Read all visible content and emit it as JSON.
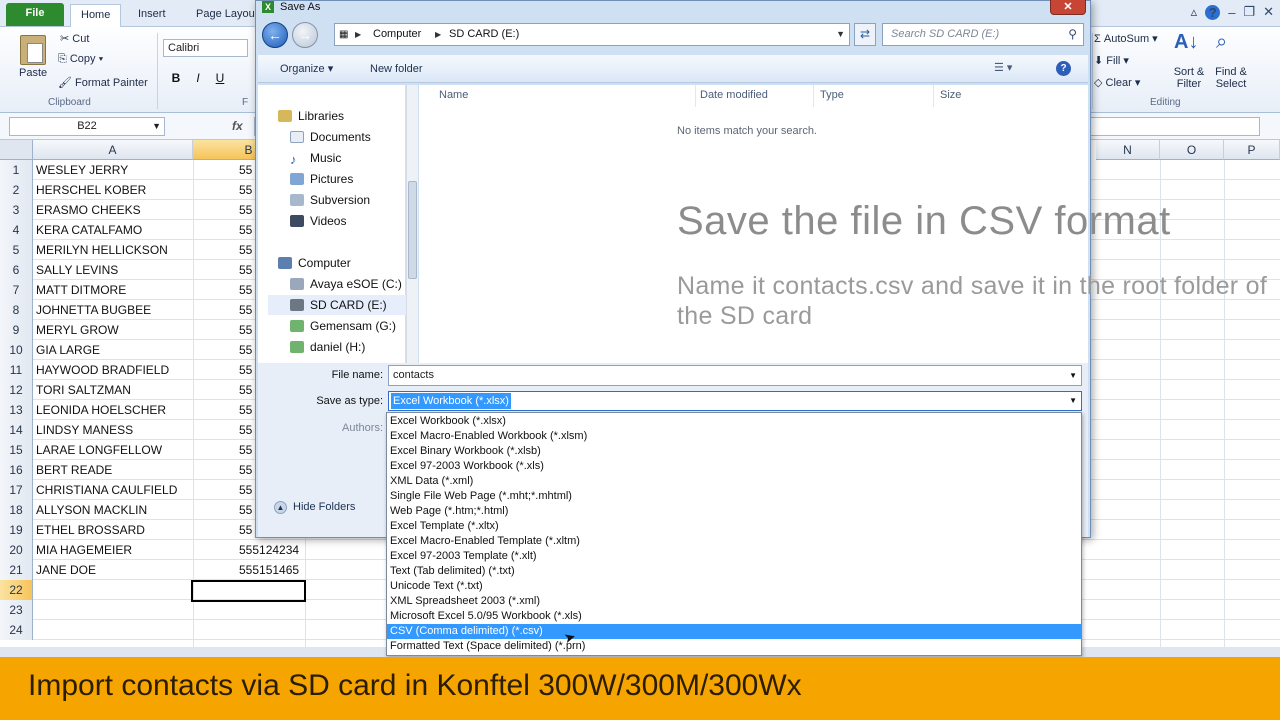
{
  "excel": {
    "tabs": [
      "File",
      "Home",
      "Insert",
      "Page Layou"
    ],
    "clipboard": {
      "paste": "Paste",
      "cut": "Cut",
      "copy": "Copy",
      "format_painter": "Format Painter",
      "label": "Clipboard"
    },
    "font": {
      "name": "Calibri",
      "bold": "B",
      "italic": "I",
      "underline": "U",
      "label_fragment": "F"
    },
    "editing": {
      "autosum": "AutoSum",
      "fill": "Fill",
      "clear": "Clear",
      "sort_filter": "Sort & Filter",
      "find_select": "Find & Select",
      "label": "Editing"
    },
    "name_box": "B22",
    "fx": "fx",
    "columns": {
      "a": "A",
      "b": "B",
      "n": "N",
      "o": "O",
      "p": "P"
    },
    "rows": [
      {
        "num": "1",
        "name": "WESLEY JERRY",
        "phone": "55"
      },
      {
        "num": "2",
        "name": "HERSCHEL KOBER",
        "phone": "55"
      },
      {
        "num": "3",
        "name": "ERASMO CHEEKS",
        "phone": "55"
      },
      {
        "num": "4",
        "name": "KERA CATALFAMO",
        "phone": "55"
      },
      {
        "num": "5",
        "name": "MERILYN HELLICKSON",
        "phone": "55"
      },
      {
        "num": "6",
        "name": "SALLY LEVINS",
        "phone": "55"
      },
      {
        "num": "7",
        "name": "MATT DITMORE",
        "phone": "55"
      },
      {
        "num": "8",
        "name": "JOHNETTA BUGBEE",
        "phone": "55"
      },
      {
        "num": "9",
        "name": "MERYL GROW",
        "phone": "55"
      },
      {
        "num": "10",
        "name": "GIA LARGE",
        "phone": "55"
      },
      {
        "num": "11",
        "name": "HAYWOOD BRADFIELD",
        "phone": "55"
      },
      {
        "num": "12",
        "name": "TORI SALTZMAN",
        "phone": "55"
      },
      {
        "num": "13",
        "name": "LEONIDA HOELSCHER",
        "phone": "55"
      },
      {
        "num": "14",
        "name": "LINDSY MANESS",
        "phone": "55"
      },
      {
        "num": "15",
        "name": "LARAE LONGFELLOW",
        "phone": "55"
      },
      {
        "num": "16",
        "name": "BERT READE",
        "phone": "55"
      },
      {
        "num": "17",
        "name": "CHRISTIANA CAULFIELD",
        "phone": "55"
      },
      {
        "num": "18",
        "name": "ALLYSON MACKLIN",
        "phone": "55"
      },
      {
        "num": "19",
        "name": "ETHEL BROSSARD",
        "phone": "55"
      },
      {
        "num": "20",
        "name": "MIA HAGEMEIER",
        "phone": "555124234"
      },
      {
        "num": "21",
        "name": "JANE DOE",
        "phone": "555151465"
      },
      {
        "num": "22",
        "name": "",
        "phone": ""
      },
      {
        "num": "23",
        "name": "",
        "phone": ""
      },
      {
        "num": "24",
        "name": "",
        "phone": ""
      }
    ]
  },
  "dialog": {
    "title": "Save As",
    "close": "✕",
    "address": [
      "Computer",
      "SD CARD (E:)"
    ],
    "search_placeholder": "Search SD CARD (E:)",
    "toolbar": {
      "organize": "Organize",
      "new_folder": "New folder"
    },
    "nav": {
      "libraries": "Libraries",
      "documents": "Documents",
      "music": "Music",
      "pictures": "Pictures",
      "subversion": "Subversion",
      "videos": "Videos",
      "computer": "Computer",
      "drive_c": "Avaya eSOE (C:)",
      "drive_e": "SD CARD (E:)",
      "drive_g": "Gemensam (G:)",
      "drive_h": "daniel (H:)"
    },
    "columns": {
      "name": "Name",
      "date": "Date modified",
      "type": "Type",
      "size": "Size"
    },
    "empty": "No items match your search.",
    "file_name_label": "File name:",
    "file_name_value": "contacts",
    "save_type_label": "Save as type:",
    "save_type_value": "Excel Workbook (*.xlsx)",
    "authors_label": "Authors:",
    "hide_folders": "Hide Folders",
    "type_options": [
      "Excel Workbook (*.xlsx)",
      "Excel Macro-Enabled Workbook (*.xlsm)",
      "Excel Binary Workbook (*.xlsb)",
      "Excel 97-2003 Workbook (*.xls)",
      "XML Data (*.xml)",
      "Single File Web Page (*.mht;*.mhtml)",
      "Web Page (*.htm;*.html)",
      "Excel Template (*.xltx)",
      "Excel Macro-Enabled Template (*.xltm)",
      "Excel 97-2003 Template (*.xlt)",
      "Text (Tab delimited) (*.txt)",
      "Unicode Text (*.txt)",
      "XML Spreadsheet 2003 (*.xml)",
      "Microsoft Excel 5.0/95 Workbook (*.xls)",
      "CSV (Comma delimited) (*.csv)",
      "Formatted Text (Space delimited) (*.prn)"
    ],
    "highlighted_option": "CSV (Comma delimited) (*.csv)"
  },
  "overlay": {
    "heading": "Save the file in CSV format",
    "subtext": "Name it contacts.csv and save it in the root folder of the SD card"
  },
  "caption": "Import contacts via SD card in Konftel 300W/300M/300Wx",
  "colors": {
    "caption_bg": "#f6a500",
    "selection": "#3399ff",
    "file_tab": "#2e8a2e"
  }
}
